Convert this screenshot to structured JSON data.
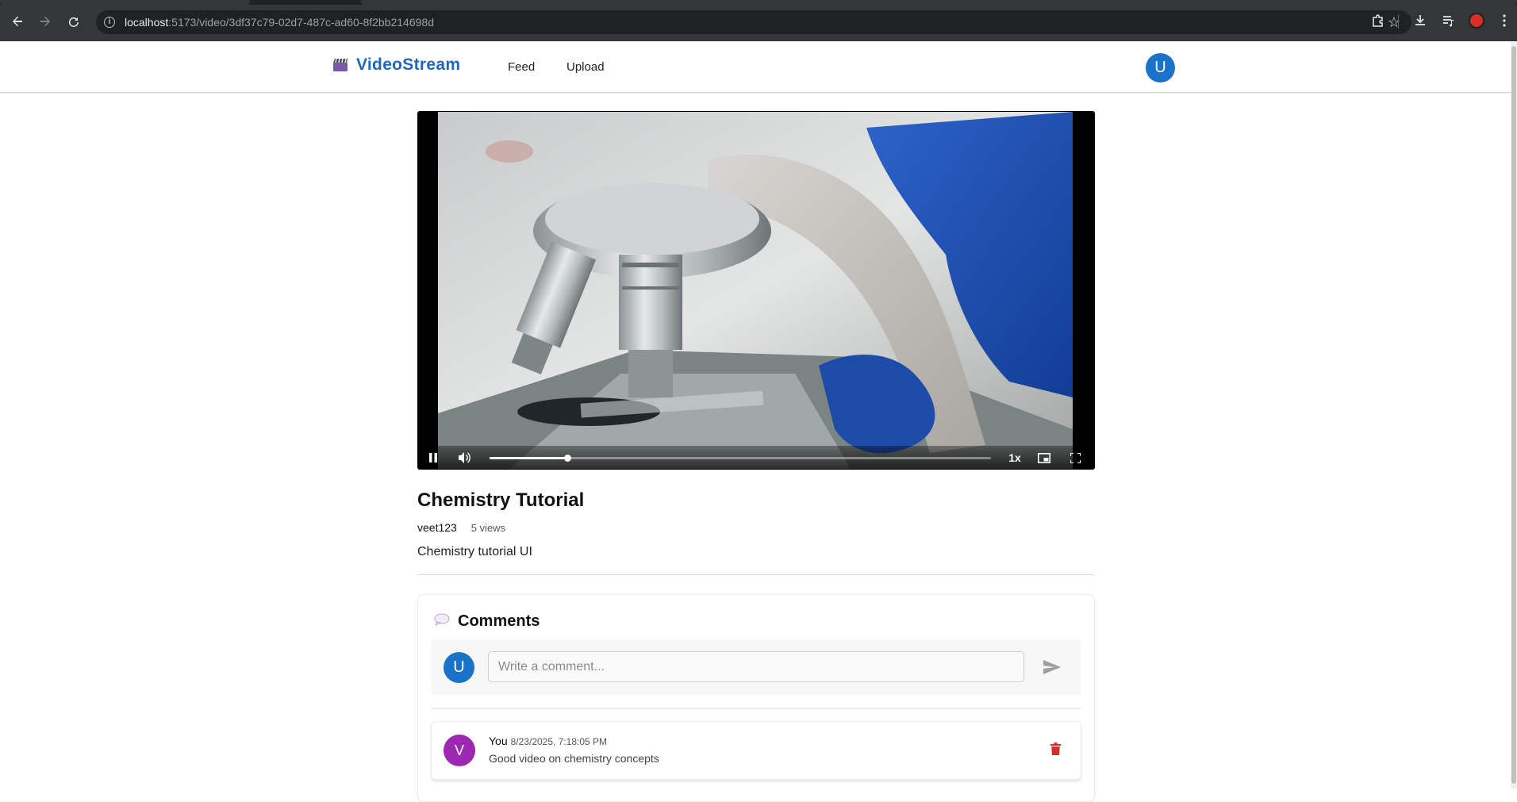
{
  "browser": {
    "url_host": "localhost",
    "url_path": ":5173/video/3df37c79-02d7-487c-ad60-8f2bb214698d"
  },
  "header": {
    "brand": "VideoStream",
    "nav": [
      "Feed",
      "Upload"
    ],
    "avatar_initial": "U",
    "accent_color": "#1f66c1",
    "avatar_color": "#1a73c8"
  },
  "player": {
    "progress": 0.155,
    "speed_label": "1x",
    "state": "playing",
    "icons": [
      "pause-icon",
      "volume-icon",
      "picture-in-picture-icon",
      "fullscreen-icon"
    ]
  },
  "video": {
    "title": "Chemistry Tutorial",
    "owner": "veet123",
    "views": "5 views",
    "description": "Chemistry tutorial UI"
  },
  "comments": {
    "heading": "Comments",
    "composer_avatar": "U",
    "placeholder": "Write a comment...",
    "items": [
      {
        "avatar": "V",
        "author": "You",
        "time": "8/23/2025, 7:18:05 PM",
        "text": "Good video on chemistry concepts",
        "avatar_color": "#9c27b0"
      }
    ],
    "delete_color": "#d32f2f"
  }
}
